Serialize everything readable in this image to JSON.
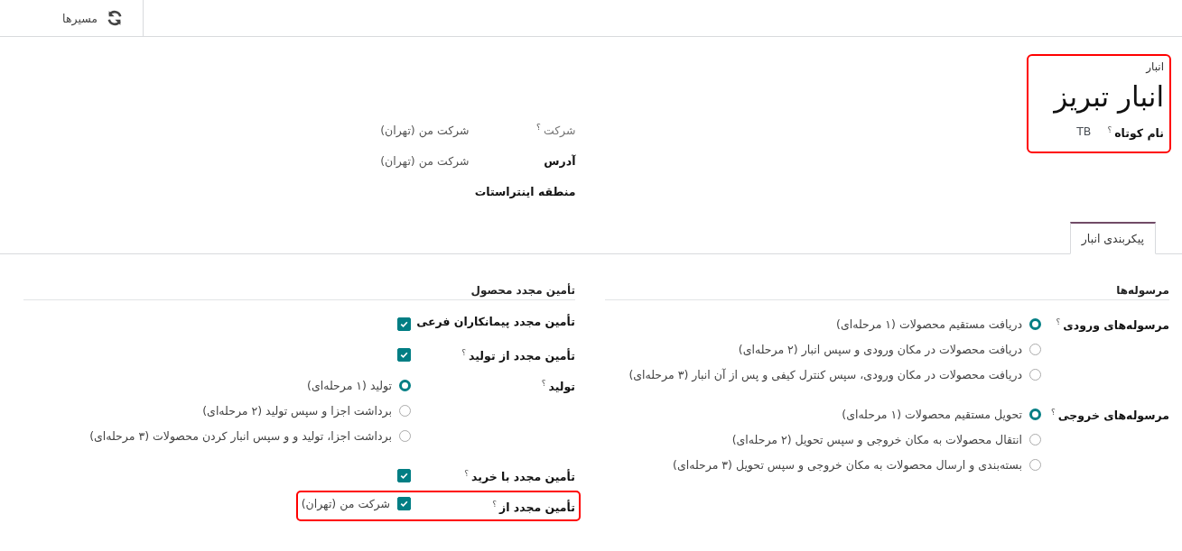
{
  "top_bar": {
    "buttons": [
      {
        "label": "مسیرها"
      }
    ]
  },
  "header": {
    "caption": "انبار",
    "title": "انبار تبریز",
    "highlighted": true,
    "fields": [
      {
        "label": "نام کوتاه",
        "help": "؟",
        "value": "TB"
      }
    ]
  },
  "info_fields": [
    {
      "label": "شرکت",
      "help": "؟",
      "muted": true,
      "value": "شرکت من (تهران)"
    },
    {
      "label": "آدرس",
      "muted": false,
      "value": "شرکت من (تهران)"
    },
    {
      "label": "منطقه اینتراستات",
      "muted": false
    }
  ],
  "tabs": [
    {
      "label": "پیکربندی انبار",
      "selected": true
    }
  ],
  "sections": [
    {
      "title": "مرسوله‌ها",
      "rows": [
        {
          "kind": "radio",
          "label": "مرسوله‌های ورودی",
          "help": "؟",
          "options": [
            {
              "label": "دریافت مستقیم محصولات (۱ مرحله‌ای)",
              "selected": true
            },
            {
              "label": "دریافت محصولات در مکان ورودی و سپس انبار (۲ مرحله‌ای)",
              "selected": false
            },
            {
              "label": "دریافت محصولات در مکان ورودی، سپس کنترل کیفی و پس از آن انبار (۳ مرحله‌ای)",
              "selected": false
            }
          ]
        },
        {
          "kind": "radio",
          "label": "مرسوله‌های خروجی",
          "help": "؟",
          "options": [
            {
              "label": "تحویل مستقیم محصولات (۱ مرحله‌ای)",
              "selected": true
            },
            {
              "label": "انتقال محصولات به مکان خروجی و سپس تحویل (۲ مرحله‌ای)",
              "selected": false
            },
            {
              "label": "بسته‌بندی و ارسال محصولات به مکان خروجی و سپس تحویل (۳ مرحله‌ای)",
              "selected": false
            }
          ]
        }
      ]
    },
    {
      "title": "تأمین مجدد محصول",
      "rows": [
        {
          "kind": "checkbox",
          "label": "تأمین مجدد پیمانکاران فرعی",
          "checked": true
        },
        {
          "kind": "checkbox",
          "label": "تأمین مجدد از تولید",
          "help": "؟",
          "checked": true
        },
        {
          "kind": "radio",
          "label": "تولید",
          "help": "؟",
          "options": [
            {
              "label": "تولید (۱ مرحله‌ای)",
              "selected": true
            },
            {
              "label": "برداشت اجزا و سپس تولید (۲ مرحله‌ای)",
              "selected": false
            },
            {
              "label": "برداشت اجزا، تولید و و سپس انبار کردن محصولات (۳ مرحله‌ای)",
              "selected": false
            }
          ]
        },
        {
          "kind": "checkbox",
          "label": "تأمین مجدد با خرید",
          "help": "؟",
          "checked": true
        },
        {
          "kind": "checklist",
          "label": "تأمین مجدد از",
          "help": "؟",
          "highlighted": true,
          "items": [
            {
              "label": "شرکت من (تهران)",
              "checked": true
            }
          ]
        }
      ]
    }
  ]
}
